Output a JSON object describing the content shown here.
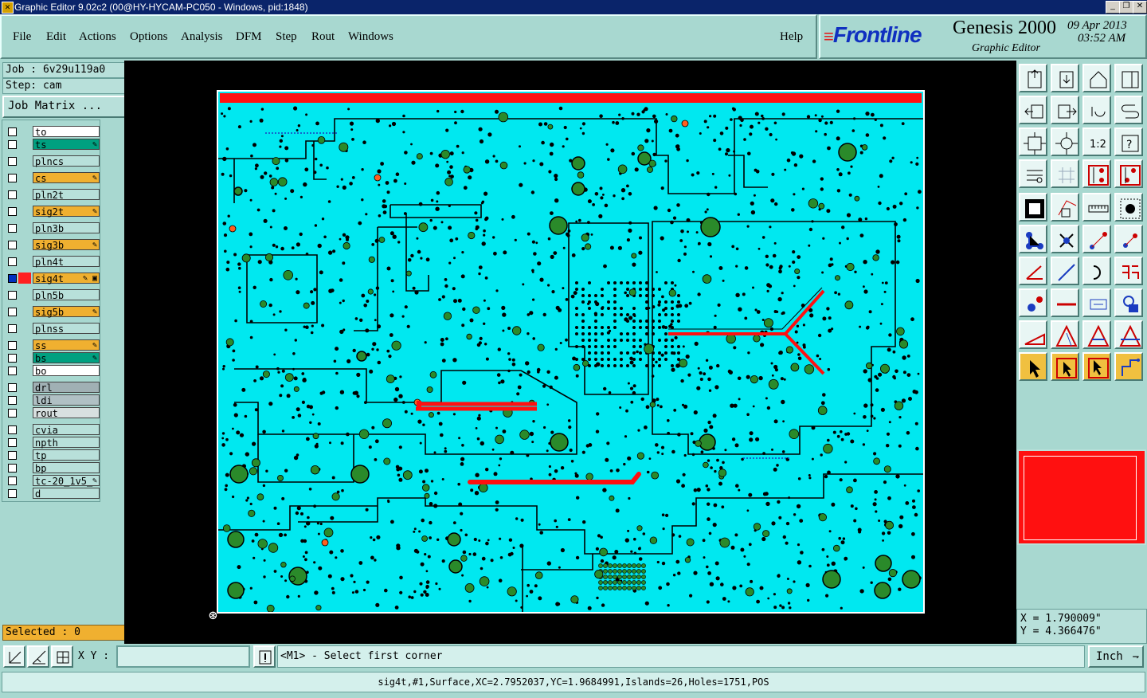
{
  "window": {
    "title": "Graphic Editor 9.02c2 (00@HY-HYCAM-PC050 - Windows, pid:1848)"
  },
  "menu": [
    "File",
    "Edit",
    "Actions",
    "Options",
    "Analysis",
    "DFM",
    "Step",
    "Rout",
    "Windows"
  ],
  "help_label": "Help",
  "brand": {
    "logo": "Frontline",
    "product": "Genesis 2000",
    "subtitle": "Graphic Editor",
    "date": "09 Apr 2013",
    "time": "03:52 AM"
  },
  "job": {
    "job_line": "Job : 6v29u119a0",
    "step_line": "Step: cam",
    "matrix_button": "Job Matrix ..."
  },
  "layers": [
    {
      "name": "to",
      "color": "#ffffff",
      "lbg": "#ffffff",
      "flag": ""
    },
    {
      "name": "ts",
      "color": "#00a080",
      "lbg": "#00a080",
      "flag": "✎"
    },
    {
      "name": "plncs",
      "color": "#b8e0da",
      "lbg": "#b8e0da",
      "flag": ""
    },
    {
      "name": "cs",
      "color": "#f0b030",
      "lbg": "#f0b030",
      "flag": "✎"
    },
    {
      "name": "pln2t",
      "color": "#b8e0da",
      "lbg": "#b8e0da",
      "flag": ""
    },
    {
      "name": "sig2t",
      "color": "#f0b030",
      "lbg": "#f0b030",
      "flag": "✎"
    },
    {
      "name": "pln3b",
      "color": "#b8e0da",
      "lbg": "#b8e0da",
      "flag": ""
    },
    {
      "name": "sig3b",
      "color": "#f0b030",
      "lbg": "#f0b030",
      "flag": "✎"
    },
    {
      "name": "pln4t",
      "color": "#b8e0da",
      "lbg": "#b8e0da",
      "flag": ""
    },
    {
      "name": "sig4t",
      "color": "#ff2020",
      "lbg": "#f0b030",
      "flag": "✎ ▣"
    },
    {
      "name": "pln5b",
      "color": "#b8e0da",
      "lbg": "#b8e0da",
      "flag": ""
    },
    {
      "name": "sig5b",
      "color": "#f0b030",
      "lbg": "#f0b030",
      "flag": "✎"
    },
    {
      "name": "plnss",
      "color": "#b8e0da",
      "lbg": "#b8e0da",
      "flag": ""
    },
    {
      "name": "ss",
      "color": "#f0b030",
      "lbg": "#f0b030",
      "flag": "✎"
    },
    {
      "name": "bs",
      "color": "#00a080",
      "lbg": "#00a080",
      "flag": "✎"
    },
    {
      "name": "bo",
      "color": "#ffffff",
      "lbg": "#ffffff",
      "flag": ""
    },
    {
      "name": "drl",
      "color": "#888888",
      "lbg": "#a0b0b4",
      "flag": ""
    },
    {
      "name": "ldi",
      "color": "#b0c0c4",
      "lbg": "#b0c0c4",
      "flag": ""
    },
    {
      "name": "rout",
      "color": "#d0d0d0",
      "lbg": "#d8e0e0",
      "flag": ""
    },
    {
      "name": "cvia",
      "color": "#b8e0da",
      "lbg": "#b8e0da",
      "flag": ""
    },
    {
      "name": "npth",
      "color": "#b8e0da",
      "lbg": "#b8e0da",
      "flag": ""
    },
    {
      "name": "tp",
      "color": "#b8e0da",
      "lbg": "#b8e0da",
      "flag": ""
    },
    {
      "name": "bp",
      "color": "#b8e0da",
      "lbg": "#b8e0da",
      "flag": ""
    },
    {
      "name": "tc-20_1v5_",
      "color": "#b8e0da",
      "lbg": "#b8e0da",
      "flag": "✎"
    },
    {
      "name": "d",
      "color": "#b8e0da",
      "lbg": "#b8e0da",
      "flag": ""
    }
  ],
  "selected": "Selected : 0",
  "coords": {
    "x": "X = 1.790009\"",
    "y": "Y = 4.366476\""
  },
  "xy_label": "X Y :",
  "xy_value": "",
  "prompt": "<M1> - Select first corner",
  "units": "Inch",
  "status": "sig4t,#1,Surface,XC=2.7952037,YC=1.9684991,Islands=26,Holes=1751,POS",
  "colors": {
    "board": "#00e8f0",
    "feature": "#000000",
    "highlight": "#ff1010",
    "pad": "#2a8a2a"
  }
}
